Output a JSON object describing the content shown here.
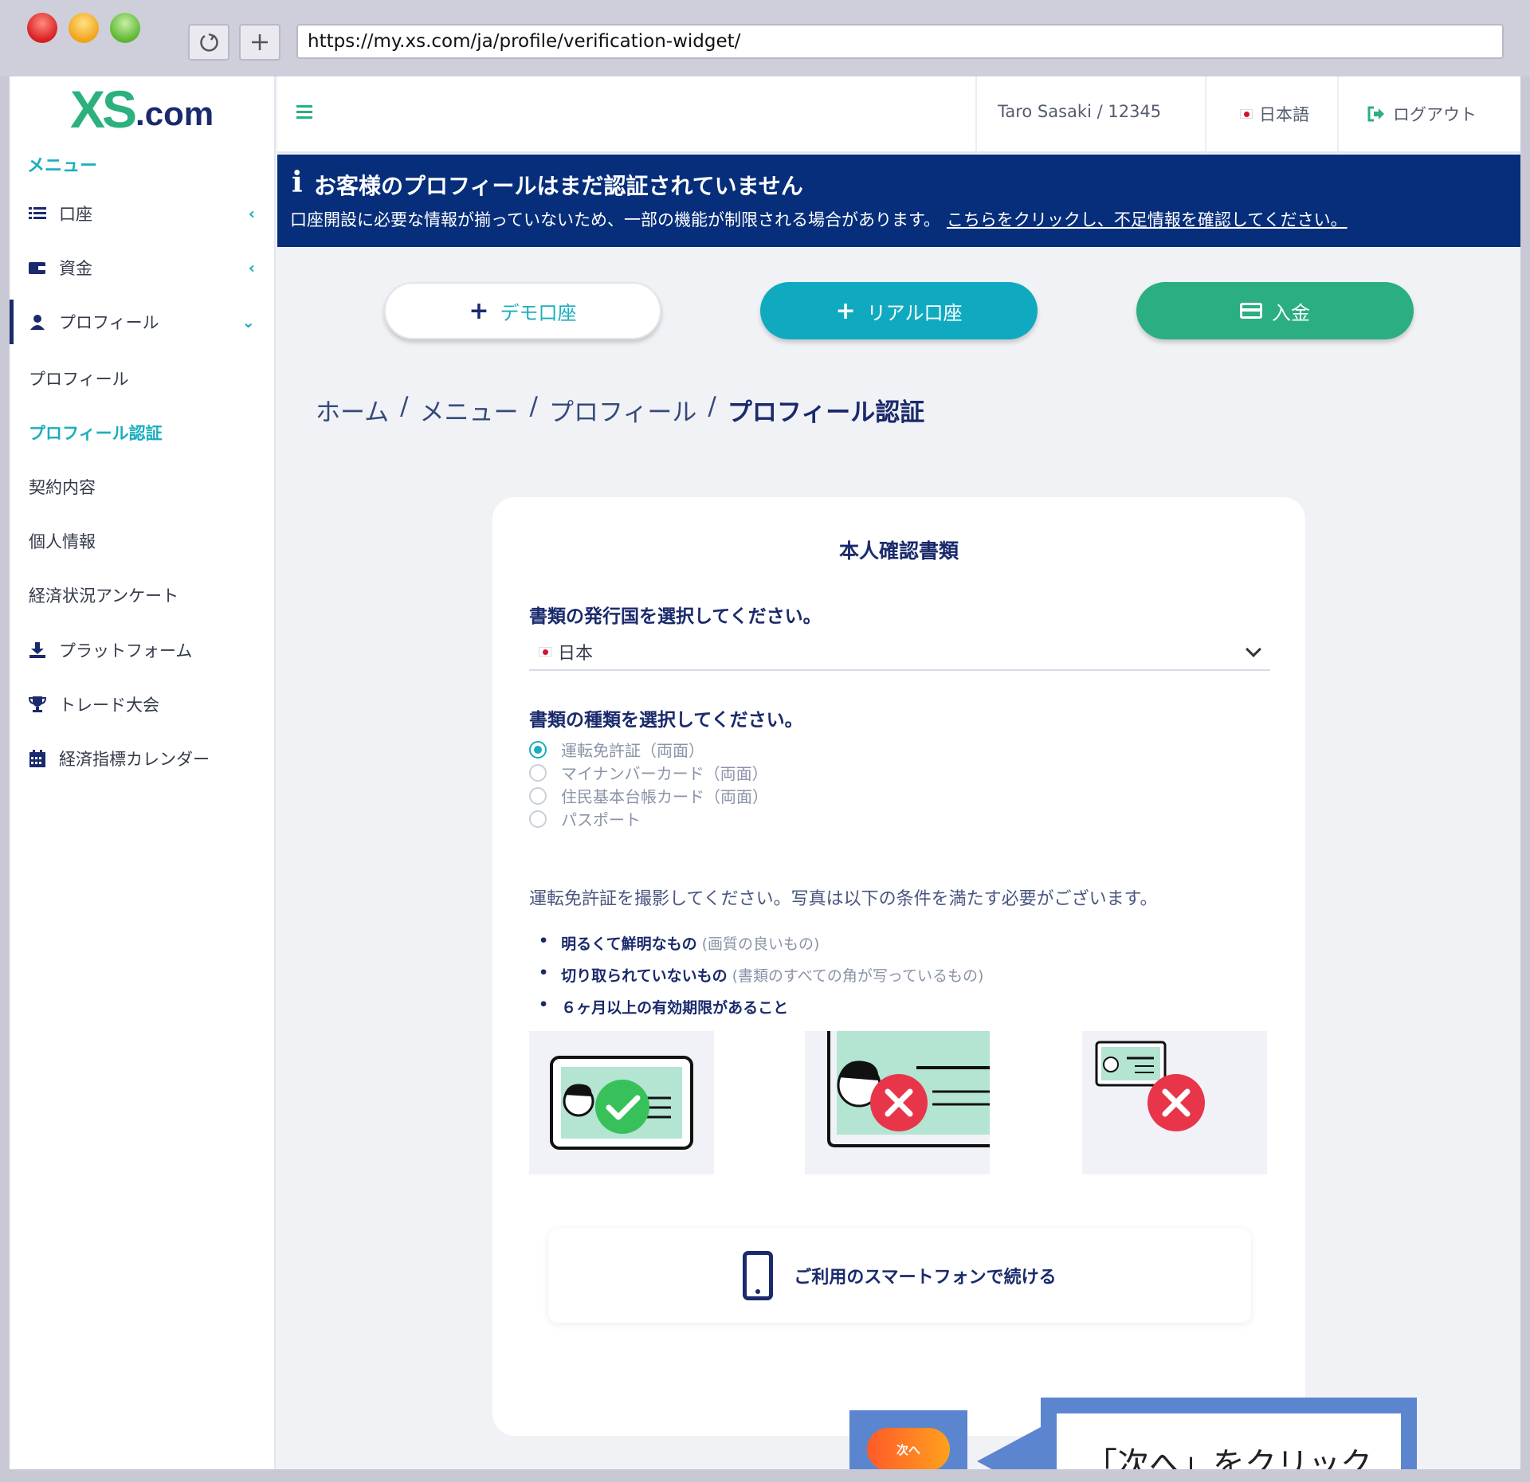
{
  "browser": {
    "url": "https://my.xs.com/ja/profile/verification-widget/",
    "reload_icon": "reload-icon",
    "newtab_icon": "plus-icon"
  },
  "logo": {
    "brand": "XS",
    "suffix": ".com"
  },
  "sidebar": {
    "menu_title": "メニュー",
    "items": [
      {
        "label": "口座",
        "icon": "list-icon"
      },
      {
        "label": "資金",
        "icon": "wallet-icon"
      },
      {
        "label": "プロフィール",
        "icon": "user-icon"
      }
    ],
    "sub_items": [
      {
        "label": "プロフィール"
      },
      {
        "label": "プロフィール認証"
      },
      {
        "label": "契約内容"
      },
      {
        "label": "個人情報"
      },
      {
        "label": "経済状況アンケート"
      }
    ],
    "bottom_items": [
      {
        "label": "プラットフォーム",
        "icon": "download-icon"
      },
      {
        "label": "トレード大会",
        "icon": "trophy-icon"
      },
      {
        "label": "経済指標カレンダー",
        "icon": "calendar-icon"
      }
    ]
  },
  "topbar": {
    "user": "Taro Sasaki / 12345",
    "language": "日本語",
    "logout": "ログアウト"
  },
  "banner": {
    "title": "お客様のプロフィールはまだ認証されていません",
    "body": "口座開設に必要な情報が揃っていないため、一部の機能が制限される場合があります。",
    "link": "こちらをクリックし、不足情報を確認してください。"
  },
  "actions": {
    "demo": "デモ口座",
    "real": "リアル口座",
    "deposit": "入金"
  },
  "breadcrumb": {
    "home": "ホーム",
    "menu": "メニュー",
    "profile": "プロフィール",
    "current": "プロフィール認証",
    "sep": "/"
  },
  "verification": {
    "title": "本人確認書類",
    "country_label": "書類の発行国を選択してください。",
    "country_value": "日本",
    "doc_type_label": "書類の種類を選択してください。",
    "doc_types": [
      {
        "label": "運転免許証（両面）",
        "selected": true
      },
      {
        "label": "マイナンバーカード（両面）",
        "selected": false
      },
      {
        "label": "住民基本台帳カード（両面）",
        "selected": false
      },
      {
        "label": "パスポート",
        "selected": false
      }
    ],
    "instruction": "運転免許証を撮影してください。写真は以下の条件を満たす必要がございます。",
    "requirements": [
      {
        "bold": "明るくて鮮明なもの",
        "note": "(画質の良いもの)"
      },
      {
        "bold": "切り取られていないもの",
        "note": "(書類のすべての角が写っているもの)"
      },
      {
        "bold": "６ヶ月以上の有効期限があること",
        "note": ""
      }
    ],
    "smartphone": "ご利用のスマートフォンで続ける",
    "next": "次へ"
  },
  "callout": {
    "text": "「次へ」をクリック"
  },
  "colors": {
    "brand_green": "#2bb07e",
    "teal": "#10aac0",
    "navy": "#1a2a6c",
    "banner": "#062e7a",
    "next_orange": "#ff7a1f",
    "annotation_blue": "#5b86cf"
  }
}
